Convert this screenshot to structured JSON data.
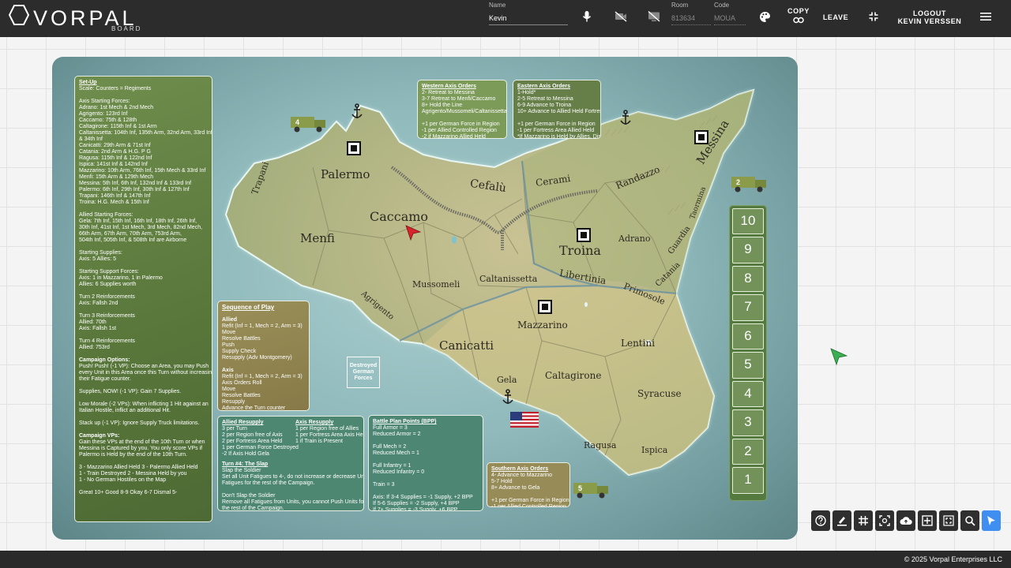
{
  "app": {
    "brand": "VORPAL",
    "brand_sub": "BOARD",
    "name_label": "Name",
    "name_value": "Kevin",
    "room_label": "Room",
    "room_value": "813634",
    "code_label": "Code",
    "code_value": "MOUA",
    "copy_label": "COPY",
    "leave_label": "LEAVE",
    "logout_label": "LOGOUT",
    "logout_user": "KEVIN VERSSEN"
  },
  "setup": {
    "lines": [
      {
        "t": "Set-Up",
        "title": true
      },
      {
        "t": "Scale: Counters = Regiments"
      },
      {
        "t": ""
      },
      {
        "t": "Axis Starting Forces:"
      },
      {
        "t": "Adrano: 1st Mech & 2nd Mech"
      },
      {
        "t": "Agrigento: 123rd Inf"
      },
      {
        "t": "Caccamo: 75th & 128th"
      },
      {
        "t": "Caltagirone: 115th Inf & 1st Arm"
      },
      {
        "t": "Caltanissetta: 104th Inf, 135th Arm, 32nd Arm, 33rd Inf"
      },
      {
        "t": "& 34th Inf"
      },
      {
        "t": "Canicatti: 29th Arm & 71st Inf"
      },
      {
        "t": "Catania: 2nd Arm & H.G. P G"
      },
      {
        "t": "Ragusa: 115th Inf & 122nd Inf"
      },
      {
        "t": "Ispica: 141st Inf & 142nd Inf"
      },
      {
        "t": "Mazzarino: 10th Arm, 76th Inf, 15th Mech & 33rd Inf"
      },
      {
        "t": "Menfi: 15th Arm & 129th Mech"
      },
      {
        "t": "Messina: 5th Inf, 6th Inf, 132nd Inf & 133rd Inf"
      },
      {
        "t": "Palermo: 6th Inf, 29th Inf, 30th Inf & 127th Inf"
      },
      {
        "t": "Trapani: 146th Inf & 147th Inf"
      },
      {
        "t": "Troina: H.G. Mech & 15th Inf"
      },
      {
        "t": ""
      },
      {
        "t": "Allied Starting Forces:"
      },
      {
        "t": "Gela: 7th Inf, 15th Inf, 16th Inf, 18th Inf, 26th Inf,"
      },
      {
        "t": "30th Inf, 41st Inf, 1st Mech, 3rd Mech, 82nd Mech,"
      },
      {
        "t": "66th Arm, 67th Arm, 70th Arm, 753rd Arm,"
      },
      {
        "t": "504th Inf, 505th Inf, & 508th Inf are Airborne"
      },
      {
        "t": ""
      },
      {
        "t": "Starting Supplies:"
      },
      {
        "t": "Axis:  5  Allies: 5"
      },
      {
        "t": ""
      },
      {
        "t": "Starting Support Forces:"
      },
      {
        "t": "Axis:    1 in Mazzarino, 1 in Palermo"
      },
      {
        "t": "Allies: 6 Supplies worth"
      },
      {
        "t": ""
      },
      {
        "t": "Turn 2 Reinforcements"
      },
      {
        "t": "Axis: Fallsh 2nd"
      },
      {
        "t": ""
      },
      {
        "t": "Turn 3 Reinforcements"
      },
      {
        "t": "Allied: 70th"
      },
      {
        "t": "Axis: Fallsh 1st"
      },
      {
        "t": ""
      },
      {
        "t": "Turn 4 Reinforcements"
      },
      {
        "t": "Allied: 753rd"
      },
      {
        "t": ""
      },
      {
        "t": "Campaign Options:",
        "bold": true
      },
      {
        "t": "Push! Push! (-1 VP): Choose an Area, you may Push"
      },
      {
        "t": "every Unit in this Area once this Turn without increasing"
      },
      {
        "t": "their Fatigue counter."
      },
      {
        "t": ""
      },
      {
        "t": "Supplies, NOW! (-1 VP): Gain 7 Supplies."
      },
      {
        "t": ""
      },
      {
        "t": "Low Morale (-2 VPs): When inflicting 1 Hit against an"
      },
      {
        "t": "Italian Hostile, inflict an additional Hit."
      },
      {
        "t": ""
      },
      {
        "t": "Stack up (-1 VP): Ignore Supply Truck limitations."
      },
      {
        "t": ""
      },
      {
        "t": "Campaign VPs:",
        "bold": true
      },
      {
        "t": "Gain these VPs at the end of the 10th Turn or when"
      },
      {
        "t": "Messina is Captured by you. You only score VPs if"
      },
      {
        "t": "Palermo is Held by the end of the 10th Turn."
      },
      {
        "t": ""
      },
      {
        "t": "3 - Mazzarino Allied Held    3 - Palermo Allied Held"
      },
      {
        "t": "1 - Train Destroyed             2 - Messina Held by you"
      },
      {
        "t": "1 - No German Hostiles on the Map"
      },
      {
        "t": ""
      },
      {
        "t": "Great  10+   Good  8-9     Okay  6-7     Dismal  5-"
      }
    ]
  },
  "western_axis_orders": {
    "title": "Western Axis Orders",
    "lines": [
      "2-    Retreat to Messina",
      "3-7  Retreat to Menfi/Caccamo",
      "8+   Hold the Line",
      "        Agrigento/Mussomeli/Caltanissetta",
      "",
      "+1 per German Force in Region",
      "-1 per Allied Controlled Region",
      "-2 if Mazzarino Allied Held"
    ]
  },
  "eastern_axis_orders": {
    "title": "Eastern Axis Orders",
    "lines": [
      "1-Hold*",
      "2-5  Retreat to Messina",
      "6-9  Advance to Troina",
      "10+ Advance to Allied Held Fortress",
      "",
      "+1 per German Force in Region",
      "-1 per Fortress Area Allied Held",
      "*If Mazzarino is Held by Allies, Discard",
      "  the lowest valued Hostile in Messina"
    ]
  },
  "sequence_of_play": {
    "title": "Sequence of Play",
    "lines": [
      {
        "t": ""
      },
      {
        "t": "Allied",
        "bold": true
      },
      {
        "t": "Refit (Inf = 1, Mech = 2, Arm = 3)"
      },
      {
        "t": "Move"
      },
      {
        "t": "Resolve Battles"
      },
      {
        "t": "Push"
      },
      {
        "t": "Supply Check"
      },
      {
        "t": "Resupply (Adv Montgomery)"
      },
      {
        "t": ""
      },
      {
        "t": "Axis",
        "bold": true
      },
      {
        "t": "Refit (Inf = 1, Mech = 2, Arm = 3)"
      },
      {
        "t": "Axis Orders Roll"
      },
      {
        "t": "Move"
      },
      {
        "t": "Resolve Battles"
      },
      {
        "t": "Resupply"
      },
      {
        "t": "Advance the Turn counter"
      }
    ]
  },
  "allied_resupply": {
    "title": "Allied Resupply",
    "lines": [
      "3 per Turn",
      "2 per Region free of Axis",
      "2 per Fortress Area Held",
      "1 per German Force Destroyed",
      "-2 If Axis Hold Gela"
    ]
  },
  "axis_resupply": {
    "title": "Axis Resupply",
    "lines": [
      "1 per Region free of Allies",
      "1 per Fortress Area Axis Held",
      "1 if Train is Present"
    ]
  },
  "turn4": {
    "title": "Turn #4: The Slap",
    "lines": [
      "Slap the Soldier",
      "Set all Unit Fatigues to 4-, do not increase or decrease Unit",
      "Fatigues for the rest of the Campaign.",
      "",
      "Don't Slap the Soldier",
      "Remove all Fatigues from Units, you cannot Push Units for",
      "the rest of the Campaign."
    ]
  },
  "bpp": {
    "title": "Battle Plan Points (BPP)",
    "lines": [
      "Full Armor = 3",
      "Reduced Armor = 2",
      "",
      "Full Mech = 2",
      "Reduced Mech = 1",
      "",
      "Full Infantry = 1",
      "Reduced Infantry = 0",
      "",
      "Train = 3",
      "",
      "Axis:  If 3-4 Supplies = -1 Supply, +2 BPP",
      "         If 5-6 Supplies = -2 Supply, +4 BPP",
      "         If 7+ Supplies = -3 Supply, +6 BPP"
    ]
  },
  "southern_axis_orders": {
    "title": "Southern Axis Orders",
    "lines": [
      "4-    Advance to Mazzarino",
      "5-7  Hold",
      "8+   Advance to Gela",
      "",
      "+1 per German Force in Region",
      "-1 per Allied Controlled Region"
    ]
  },
  "destroyed_box": {
    "line1": "Destroyed",
    "line2": "German",
    "line3": "Forces"
  },
  "turn_track": [
    "10",
    "9",
    "8",
    "7",
    "6",
    "5",
    "4",
    "3",
    "2",
    "1"
  ],
  "places": {
    "palermo": "Palermo",
    "trapani": "Trapani",
    "caccamo": "Caccamo",
    "cefalu": "Cefalù",
    "cerami": "Cerami",
    "randazzo": "Randazzo",
    "messina": "Messina",
    "taormina": "Taormina",
    "menfi": "Menfi",
    "agrigento": "Agrigento",
    "mussomeli": "Mussomeli",
    "caltanissetta": "Caltanissetta",
    "troina": "Troina",
    "adrano": "Adrano",
    "guardia": "Guardia",
    "libertinia": "Libertinia",
    "catania": "Catania",
    "primosole": "Primosole",
    "mazzarino": "Mazzarino",
    "canicatti": "Canicatti",
    "lentini": "Lentini",
    "gela": "Gela",
    "caltagirone": "Caltagirone",
    "syracuse": "Syracuse",
    "ragusa": "Ragusa",
    "ispica": "Ispica"
  },
  "trucks": {
    "t4": "4",
    "t2": "2",
    "t5": "5"
  },
  "footer": {
    "copyright": "© 2025 Vorpal Enterprises LLC"
  },
  "icons": [
    "microphone-icon",
    "camera-off-icon",
    "screen-share-off-icon",
    "palette-icon",
    "link-icon",
    "fullscreen-exit-icon",
    "menu-icon",
    "help-icon",
    "brush-icon",
    "grid-icon",
    "focus-icon",
    "cloud-upload-icon",
    "add-box-icon",
    "fit-screen-icon",
    "zoom-icon",
    "pointer-icon"
  ],
  "colors": {
    "topbar": "#2c2c2c",
    "accent": "#3f8ef2",
    "sea": "#8fb9bb",
    "panel_green": "#58763a"
  }
}
